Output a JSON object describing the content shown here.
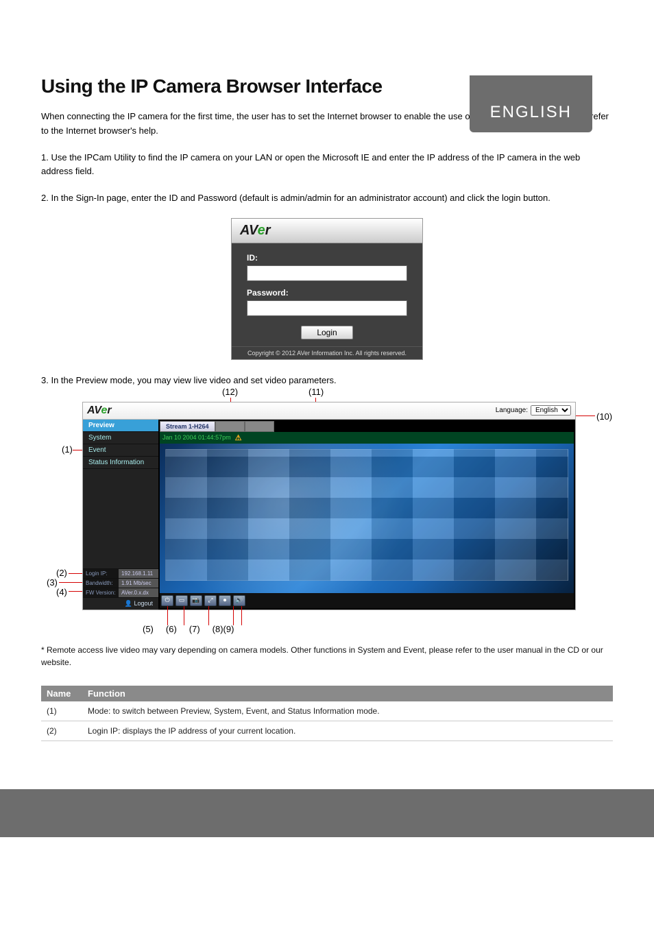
{
  "lang_tab": "ENGLISH",
  "heading": "Using the IP Camera Browser Interface",
  "intro_para": "When connecting the IP camera for the first time, the user has to set the Internet browser to enable the use of ActiveX components. Please refer to the Internet browser's help.",
  "step1_prefix": "1. ",
  "step1_text": "Use the IPCam Utility to find the IP camera on your LAN or open the Microsoft IE and enter the IP address of the IP camera in the web address field.",
  "step2_prefix": "2. ",
  "step2_text": "In the Sign-In page, enter the ID and Password (default is admin/admin for an administrator account) and click the login button.",
  "login": {
    "id_label": "ID:",
    "pw_label": "Password:",
    "btn": "Login",
    "copyright": "Copyright © 2012 AVer Information Inc. All rights reserved."
  },
  "step3_prefix": "3. ",
  "step3_text": "In the Preview mode, you may view live video and set video parameters.",
  "annots": {
    "a12": "(12)",
    "a11": "(11)",
    "a10": "(10)",
    "a1": "(1)",
    "a2": "(2)",
    "a3": "(3)",
    "a4": "(4)",
    "a5": "(5)",
    "a6": "(6)",
    "a7": "(7)",
    "a8_9": "(8)(9)"
  },
  "app": {
    "logo_left": "AV",
    "logo_g": "e",
    "logo_right": "r",
    "language_label": "Language:",
    "language_value": "English",
    "nav": {
      "preview": "Preview",
      "system": "System",
      "event": "Event",
      "status": "Status Information"
    },
    "side": {
      "login_ip_k": "Login IP:",
      "login_ip_v": "192.168.1.11",
      "bw_k": "Bandwidth:",
      "bw_v": "1.91 Mb/sec",
      "fw_k": "FW Version:",
      "fw_v": "AVer.0.x.dx"
    },
    "logout": "Logout",
    "tabs": {
      "s1": "Stream 1-H264"
    },
    "timestamp": "Jan 10 2004 01:44:57pm"
  },
  "disclaimer": "* Remote access live video may vary depending on camera models. Other functions in System and Event, please refer to the user manual in the CD or our website.",
  "table": {
    "h1": "Name",
    "h2": "Function",
    "r1_name": "(1)",
    "r1_func": "Mode: to switch between Preview, System, Event, and Status Information mode.",
    "r2_name": "(2)",
    "r2_func": "Login IP: displays the IP address of your current location."
  }
}
